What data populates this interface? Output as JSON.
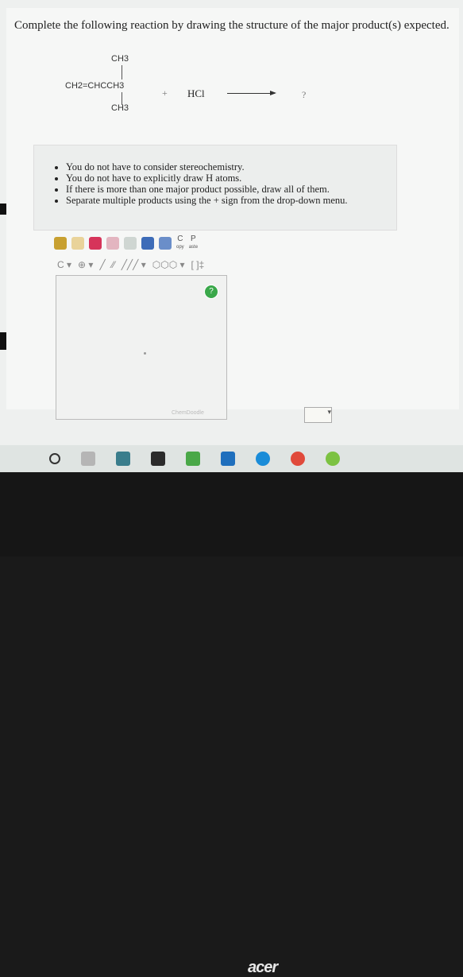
{
  "question": "Complete the following reaction by drawing the structure of the major product(s) expected.",
  "reactant": {
    "top_methyl": "CH3",
    "main_chain": "CH2=CHCCH3",
    "bottom_methyl": "CH3"
  },
  "plus": "+",
  "reagent": "HCl",
  "product": "?",
  "instructions": [
    "You do not have to consider stereochemistry.",
    "You do not have to explicitly draw H atoms.",
    "If there is more than one major product possible, draw all of them.",
    "Separate multiple products using the + sign from the drop-down menu."
  ],
  "toolbar": {
    "copy_label": "C",
    "copy_sub": "opy",
    "paste_label": "P",
    "paste_sub": "aste",
    "bracket_label": "[ ]‡",
    "help_label": "?"
  },
  "canvas": {
    "watermark": "ChemDoodle"
  },
  "brand": "acer",
  "colors": {
    "help_green": "#3aa84a",
    "pencil_red": "#d6345a"
  }
}
